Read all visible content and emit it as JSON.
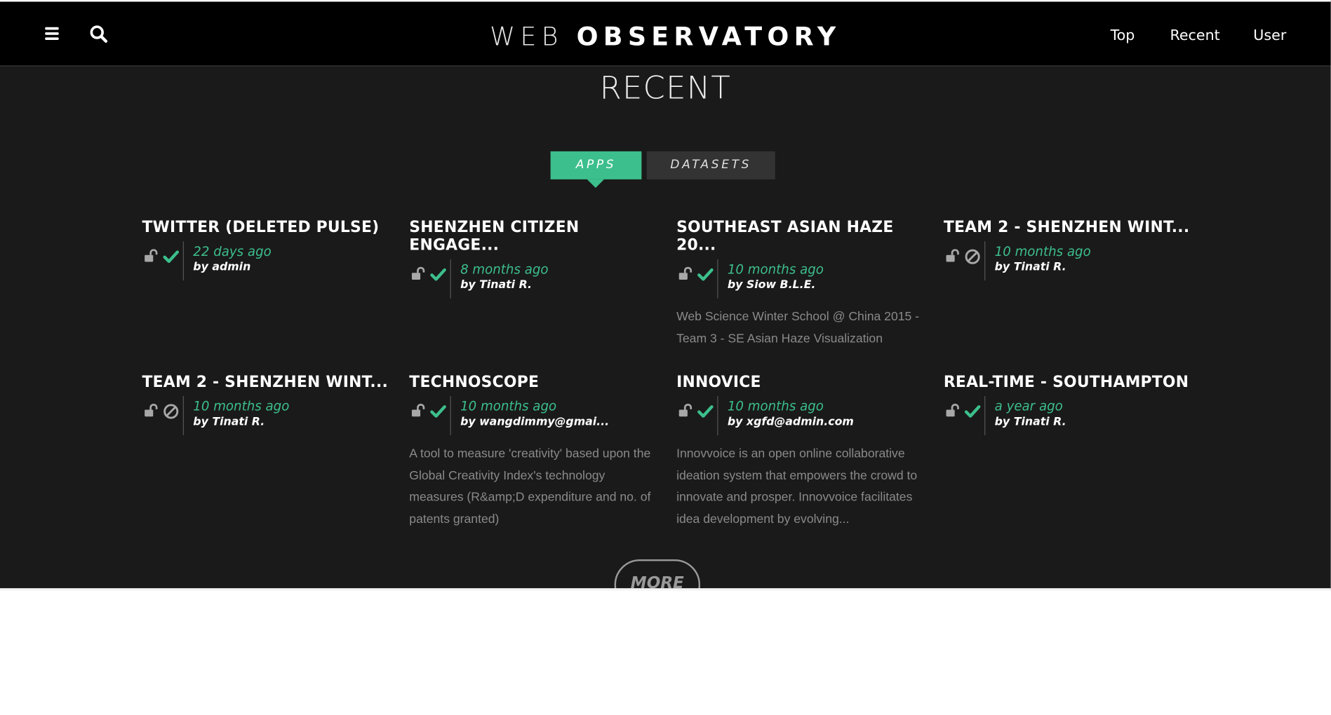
{
  "header": {
    "brand_light": "WEB",
    "brand_bold": "OBSERVATORY",
    "nav": [
      "Top",
      "Recent",
      "User"
    ]
  },
  "section": {
    "title": "RECENT"
  },
  "tabs": [
    {
      "label": "APPS",
      "active": true
    },
    {
      "label": "DATASETS",
      "active": false
    }
  ],
  "cards": [
    {
      "title": "TWITTER (DELETED PULSE)",
      "time": "22 days ago",
      "author": "by admin",
      "status": "check",
      "description": ""
    },
    {
      "title": "SHENZHEN CITIZEN ENGAGE...",
      "time": "8 months ago",
      "author": "by Tinati R.",
      "status": "check",
      "description": ""
    },
    {
      "title": "SOUTHEAST ASIAN HAZE 20...",
      "time": "10 months ago",
      "author": "by Siow B.L.E.",
      "status": "check",
      "description": "Web Science Winter School @ China 2015 - Team 3 - SE Asian Haze Visualization"
    },
    {
      "title": "TEAM 2 - SHENZHEN WINT...",
      "time": "10 months ago",
      "author": "by Tinati R.",
      "status": "blocked",
      "description": ""
    },
    {
      "title": "TEAM 2 - SHENZHEN WINT...",
      "time": "10 months ago",
      "author": "by Tinati R.",
      "status": "blocked",
      "description": ""
    },
    {
      "title": "TECHNOSCOPE",
      "time": "10 months ago",
      "author": "by wangdimmy@gmai...",
      "status": "check",
      "description": "A tool to measure 'creativity' based upon the Global Creativity Index's technology measures (R&amp;D expenditure and no. of patents granted)"
    },
    {
      "title": "INNOVICE",
      "time": "10 months ago",
      "author": "by xgfd@admin.com",
      "status": "check",
      "description": "Innovvoice is an open online collaborative ideation system that empowers the crowd to innovate and prosper. Innovvoice facilitates idea development by evolving..."
    },
    {
      "title": "REAL-TIME - SOUTHAMPTON",
      "time": "a year ago",
      "author": "by Tinati R.",
      "status": "check",
      "description": ""
    }
  ],
  "more_label": "MORE",
  "colors": {
    "accent": "#3cbf8c",
    "background": "#1a1a1a",
    "header": "#000000"
  },
  "icons": {
    "menu": "hamburger-icon",
    "search": "search-icon",
    "lock": "unlocked-padlock-icon",
    "check": "checkmark-icon",
    "blocked": "prohibited-icon"
  }
}
